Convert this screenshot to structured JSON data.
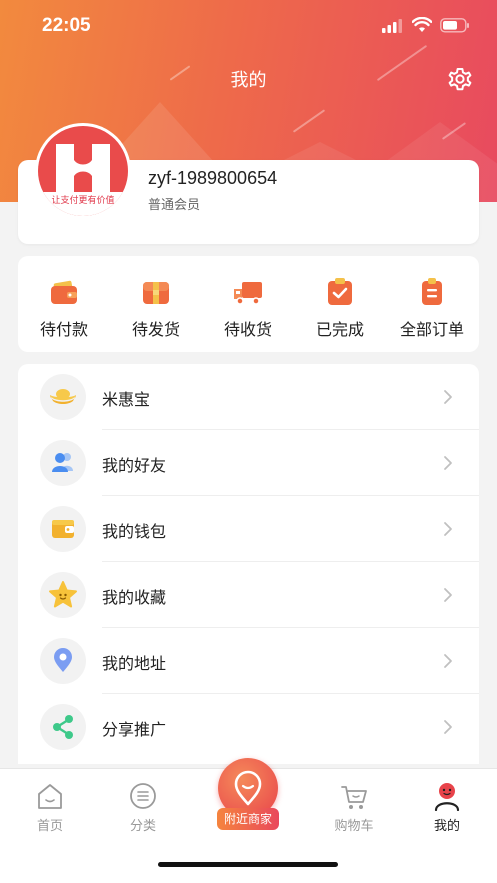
{
  "status": {
    "time": "22:05"
  },
  "header": {
    "title": "我的"
  },
  "profile": {
    "username": "zyf-1989800654",
    "level": "普通会员",
    "avatar_caption": "让支付更有价值"
  },
  "orders": [
    {
      "label": "待付款",
      "icon": "wallet-icon"
    },
    {
      "label": "待发货",
      "icon": "gift-box-icon"
    },
    {
      "label": "待收货",
      "icon": "truck-icon"
    },
    {
      "label": "已完成",
      "icon": "checked-clipboard-icon"
    },
    {
      "label": "全部订单",
      "icon": "order-list-icon"
    }
  ],
  "menu": [
    {
      "label": "米惠宝",
      "icon": "gold-ingot-icon"
    },
    {
      "label": "我的好友",
      "icon": "friends-icon"
    },
    {
      "label": "我的钱包",
      "icon": "wallet-icon"
    },
    {
      "label": "我的收藏",
      "icon": "star-icon"
    },
    {
      "label": "我的地址",
      "icon": "location-pin-icon"
    },
    {
      "label": "分享推广",
      "icon": "share-icon"
    }
  ],
  "tabbar": {
    "items": [
      {
        "label": "首页",
        "icon": "home-icon",
        "active": false
      },
      {
        "label": "分类",
        "icon": "category-icon",
        "active": false
      },
      {
        "label": "购物车",
        "icon": "cart-icon",
        "active": false
      },
      {
        "label": "我的",
        "icon": "profile-icon",
        "active": true
      }
    ],
    "center_label": "附近商家",
    "center_icon": "nearby-pin-icon"
  },
  "colors": {
    "brand_orange": "#f28a3e",
    "brand_red": "#e84a5f"
  }
}
